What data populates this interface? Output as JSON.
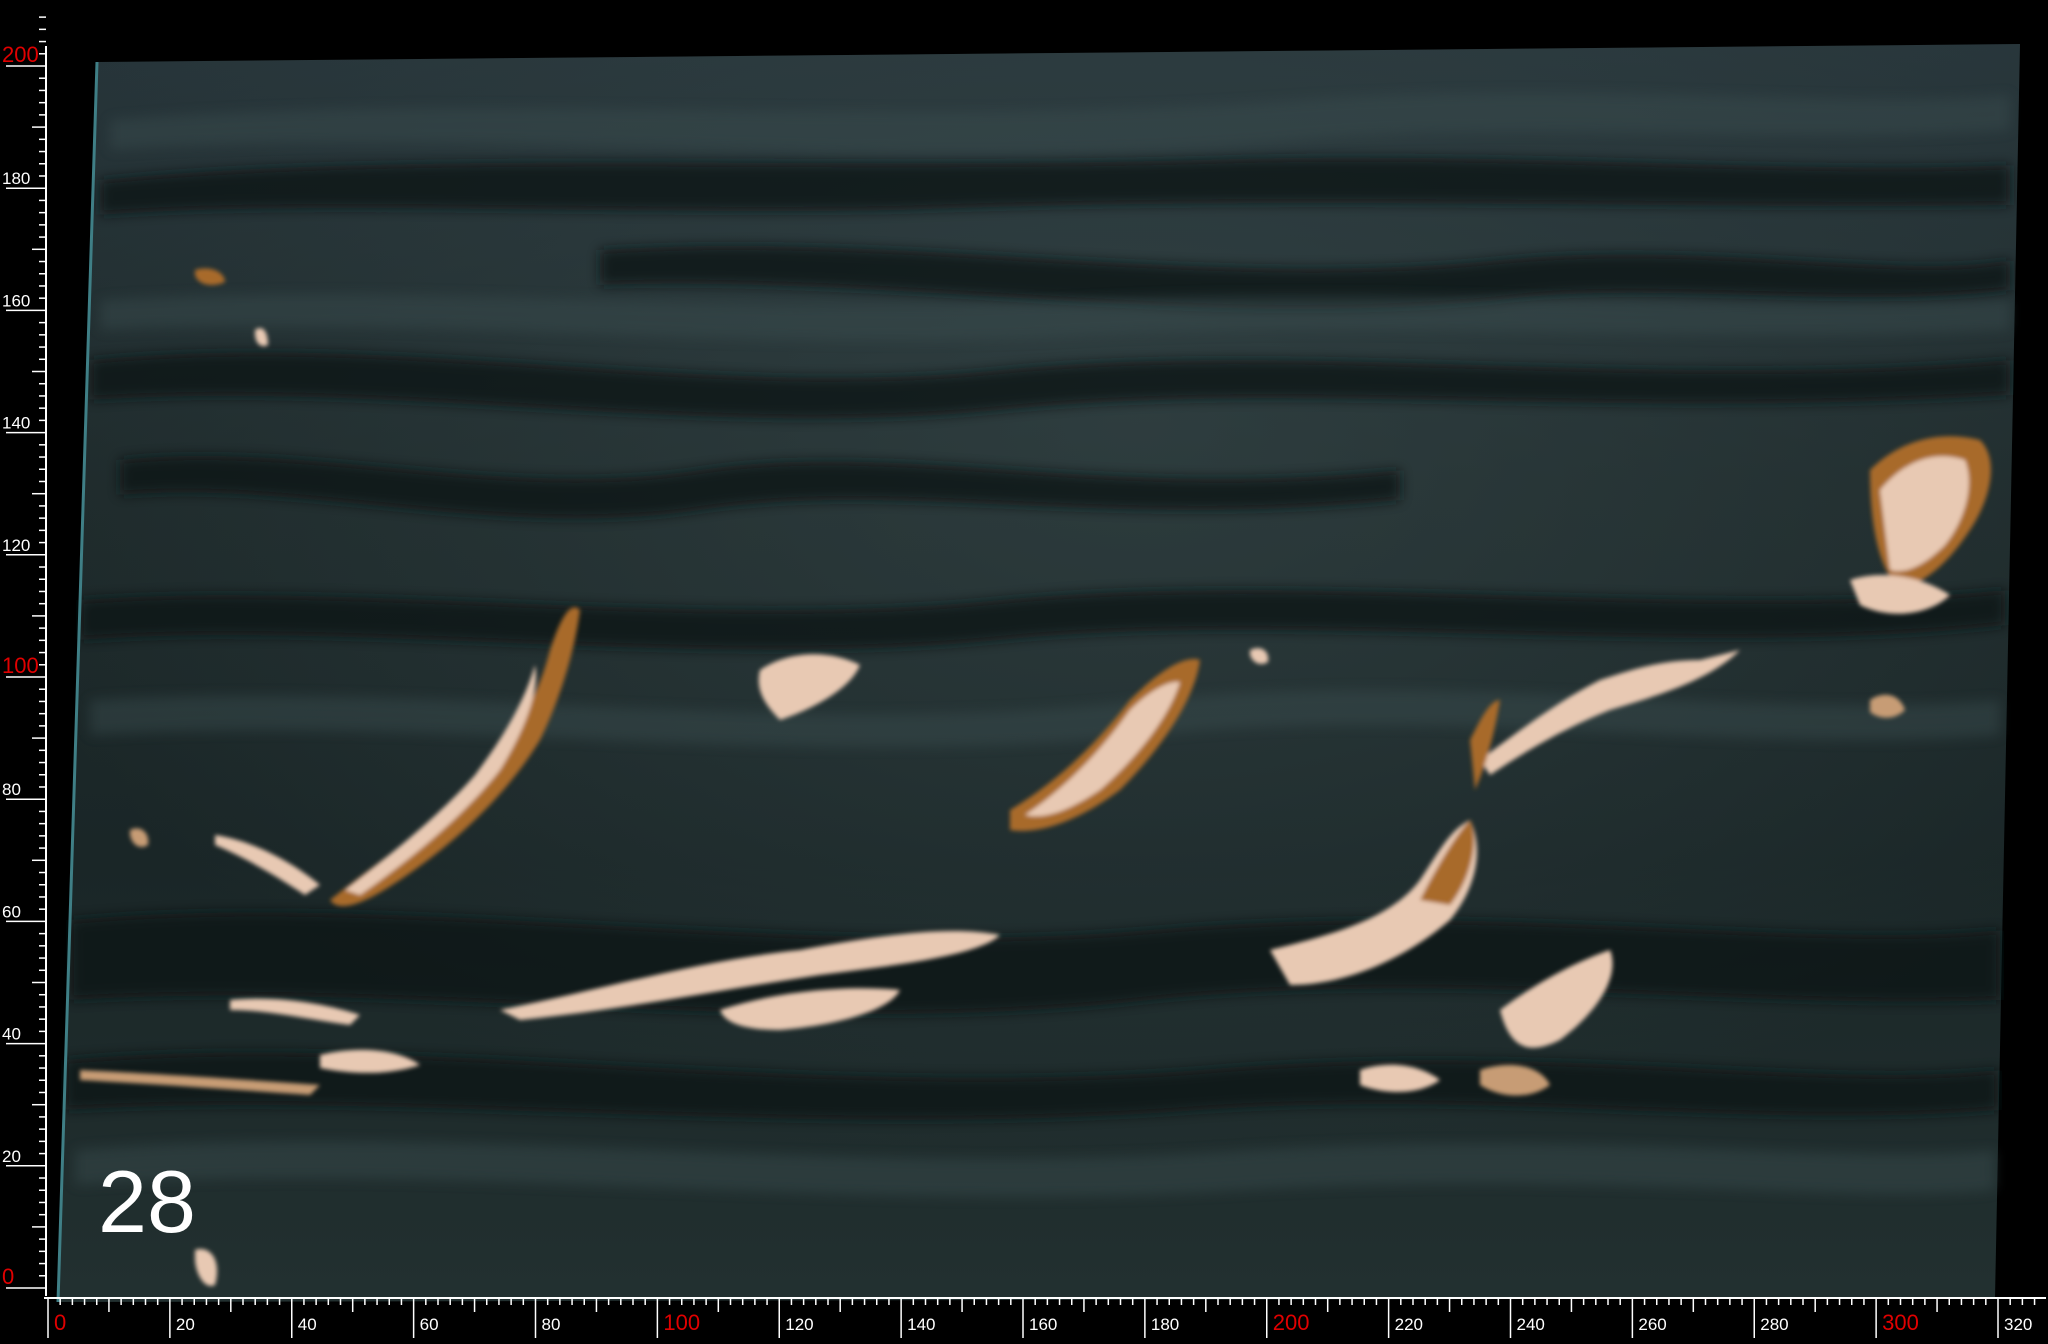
{
  "slab": {
    "number_label": "28",
    "colors": {
      "base": "#1f2b2b",
      "dark_vein": "#0a1112",
      "light_vein": "#3a4c4c",
      "inclusion_light": "#e8c9b3",
      "inclusion_rust": "#a86a2a"
    }
  },
  "ruler": {
    "colors": {
      "major_label": "#e00000",
      "minor_label": "#ffffff",
      "ticks": "#ffffff"
    },
    "vertical_labels": [
      {
        "value": "0",
        "major": true
      },
      {
        "value": "20",
        "major": false
      },
      {
        "value": "40",
        "major": false
      },
      {
        "value": "60",
        "major": false
      },
      {
        "value": "80",
        "major": false
      },
      {
        "value": "100",
        "major": true
      },
      {
        "value": "120",
        "major": false
      },
      {
        "value": "140",
        "major": false
      },
      {
        "value": "160",
        "major": false
      },
      {
        "value": "180",
        "major": false
      },
      {
        "value": "200",
        "major": true
      }
    ],
    "horizontal_labels": [
      {
        "value": "0",
        "major": true
      },
      {
        "value": "20",
        "major": false
      },
      {
        "value": "40",
        "major": false
      },
      {
        "value": "60",
        "major": false
      },
      {
        "value": "80",
        "major": false
      },
      {
        "value": "100",
        "major": true
      },
      {
        "value": "120",
        "major": false
      },
      {
        "value": "140",
        "major": false
      },
      {
        "value": "160",
        "major": false
      },
      {
        "value": "180",
        "major": false
      },
      {
        "value": "200",
        "major": true
      },
      {
        "value": "220",
        "major": false
      },
      {
        "value": "240",
        "major": false
      },
      {
        "value": "260",
        "major": false
      },
      {
        "value": "280",
        "major": false
      },
      {
        "value": "300",
        "major": true
      },
      {
        "value": "320",
        "major": false
      }
    ]
  }
}
